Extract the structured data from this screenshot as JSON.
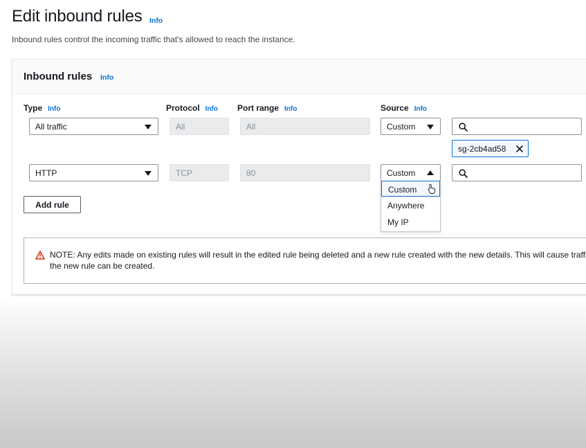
{
  "page": {
    "title": "Edit inbound rules",
    "title_info": "Info",
    "description": "Inbound rules control the incoming traffic that's allowed to reach the instance."
  },
  "panel": {
    "title": "Inbound rules",
    "title_info": "Info",
    "columns": {
      "type": "Type",
      "protocol": "Protocol",
      "port_range": "Port range",
      "source": "Source",
      "info": "Info"
    },
    "rules": [
      {
        "type": "All traffic",
        "protocol": "All",
        "port_range": "All",
        "source": "Custom",
        "search_value": "",
        "token": "sg-2cb4ad58"
      },
      {
        "type": "HTTP",
        "protocol": "TCP",
        "port_range": "80",
        "source": "Custom",
        "search_value": ""
      }
    ],
    "source_dropdown": {
      "expanded": true,
      "options": [
        "Custom",
        "Anywhere",
        "My IP"
      ],
      "highlighted": "Custom"
    },
    "add_rule_label": "Add rule",
    "note": "NOTE: Any edits made on existing rules will result in the edited rule being deleted and a new rule created with the new details. This will cause traffic t the new rule can be created."
  },
  "icons": {
    "caret": "chevron-down-icon",
    "caret_up": "chevron-up-icon",
    "search": "search-icon",
    "remove": "close-icon",
    "warning": "warning-icon",
    "cursor": "hand-pointer-icon"
  },
  "colors": {
    "link": "#0972d3",
    "warning": "#d13212",
    "token_bg": "#f2f8fd",
    "disabled_bg": "#e9ebed"
  }
}
